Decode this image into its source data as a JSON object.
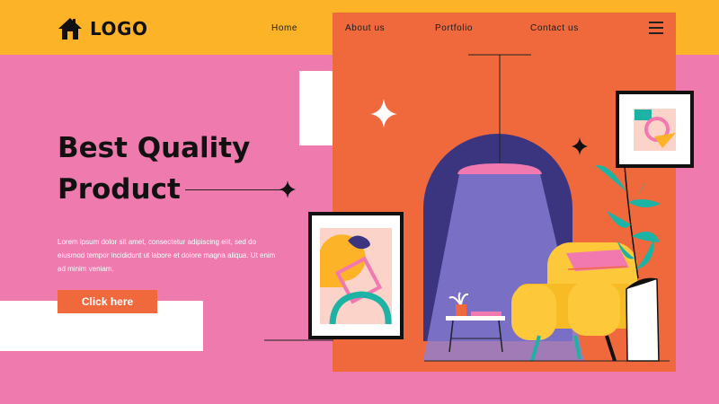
{
  "brand": {
    "logo_text": "LOGO",
    "icon": "home-icon"
  },
  "nav": {
    "items": [
      "Home",
      "About us",
      "Portfolio",
      "Contact us"
    ],
    "menu_icon": "hamburger-menu-icon"
  },
  "hero": {
    "title_line1": "Best Quality",
    "title_line2": "Product",
    "body": "Lorem ipsum dolor sit amet, consectetur adipiscing elit, sed do eiusmod tempor incididunt ut labore et dolore magna aliqua. Ut enim ad minim veniam.",
    "cta_label": "Click here"
  },
  "colors": {
    "header": "#fdb327",
    "background": "#ef7aad",
    "panel": "#f0693c",
    "arch": "#3b3580",
    "chair": "#fdc93a",
    "plant": "#1db3a4"
  }
}
